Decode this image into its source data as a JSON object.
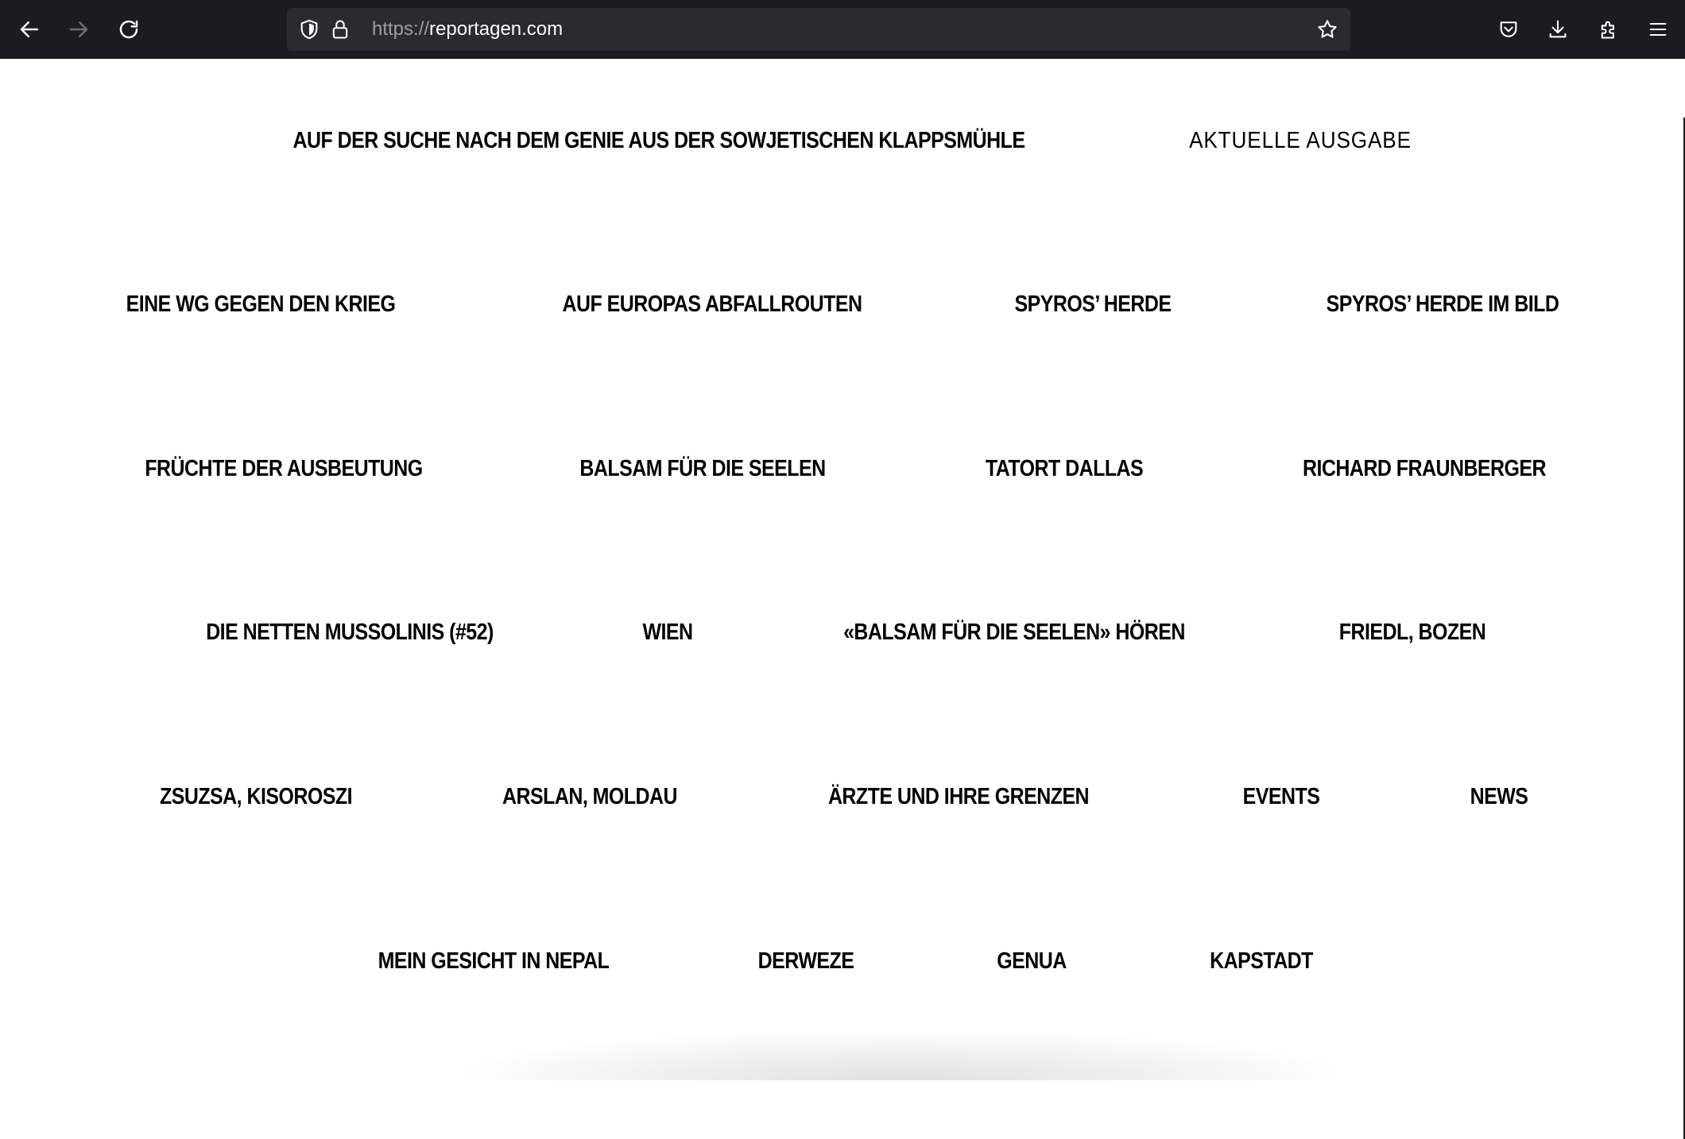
{
  "browser": {
    "url_scheme": "https://",
    "url_host": "reportagen.com",
    "icons": {
      "back": "back-arrow-icon",
      "forward": "forward-arrow-icon",
      "reload": "reload-icon",
      "shield": "shield-icon",
      "lock": "lock-icon",
      "bookmark": "star-icon",
      "pocket": "pocket-icon",
      "downloads": "download-icon",
      "extensions": "puzzle-icon",
      "menu": "hamburger-menu-icon"
    }
  },
  "page": {
    "header": {
      "featured_link": "AUF DER SUCHE NACH DEM GENIE AUS DER SOWJETISCHEN KLAPPSMÜHLE",
      "current_issue": "AKTUELLE AUSGABE"
    },
    "rows": [
      [
        "EINE WG GEGEN DEN KRIEG",
        "AUF EUROPAS ABFALLROUTEN",
        "SPYROS’ HERDE",
        "SPYROS’ HERDE  IM BILD"
      ],
      [
        "FRÜCHTE DER  AUSBEUTUNG",
        "BALSAM FÜR DIE SEELEN",
        "TATORT DALLAS",
        "RICHARD FRAUNBERGER"
      ],
      [
        "DIE NETTEN MUSSOLINIS (#52)",
        "WIEN",
        "«BALSAM FÜR DIE SEELEN» HÖREN",
        "FRIEDL, BOZEN"
      ],
      [
        "ZSUZSA, KISOROSZI",
        "ARSLAN, MOLDAU",
        "ÄRZTE UND IHRE GRENZEN",
        "EVENTS",
        "NEWS"
      ],
      [
        "MEIN GESICHT IN NEPAL",
        "DERWEZE",
        "GENUA",
        "KAPSTADT"
      ]
    ]
  }
}
